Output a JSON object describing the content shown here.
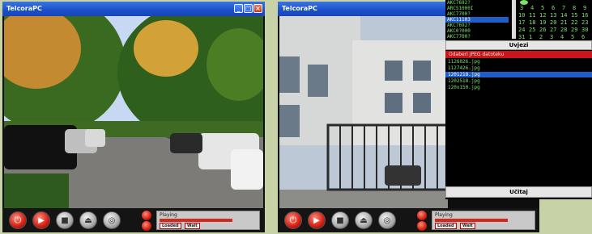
{
  "left_window": {
    "title": "TelcoraPC",
    "status_label": "Playing",
    "chip1": "Loaded",
    "chip2": "Wait"
  },
  "right_window": {
    "title": "TelcoraPC",
    "status_label": "Playing",
    "chip1": "Loaded",
    "chip2": "Wait"
  },
  "side_panel": {
    "top_list": [
      "AKC7692?",
      "ARCS1000I",
      "AKC7700?",
      "AKC11103",
      "AKC7692?",
      "AKC0?000",
      "AKC7700?"
    ],
    "selected_top_index": 3,
    "uvjezi_label": "Uvjezi",
    "header_text": "Odaberi JPEG datoteku",
    "files": [
      "1126026.jpg",
      "1127426.jpg",
      "1201218.jpg",
      "1202518.jpg",
      "120x150.jpg"
    ],
    "selected_file_index": 2,
    "ucitaj_label": "Učitaj"
  },
  "calendar": {
    "rows": [
      [
        "",
        "",
        "",
        "",
        "",
        "",
        ""
      ],
      [
        "3",
        "4",
        "5",
        "6",
        "7",
        "8",
        "9"
      ],
      [
        "10",
        "11",
        "12",
        "13",
        "14",
        "15",
        "16"
      ],
      [
        "17",
        "18",
        "19",
        "20",
        "21",
        "22",
        "23"
      ],
      [
        "24",
        "25",
        "26",
        "27",
        "28",
        "29",
        "30"
      ],
      [
        "31",
        "1",
        "2",
        "3",
        "4",
        "5",
        "6"
      ]
    ]
  },
  "progress": {
    "left": 0.7,
    "right": 0.7
  }
}
